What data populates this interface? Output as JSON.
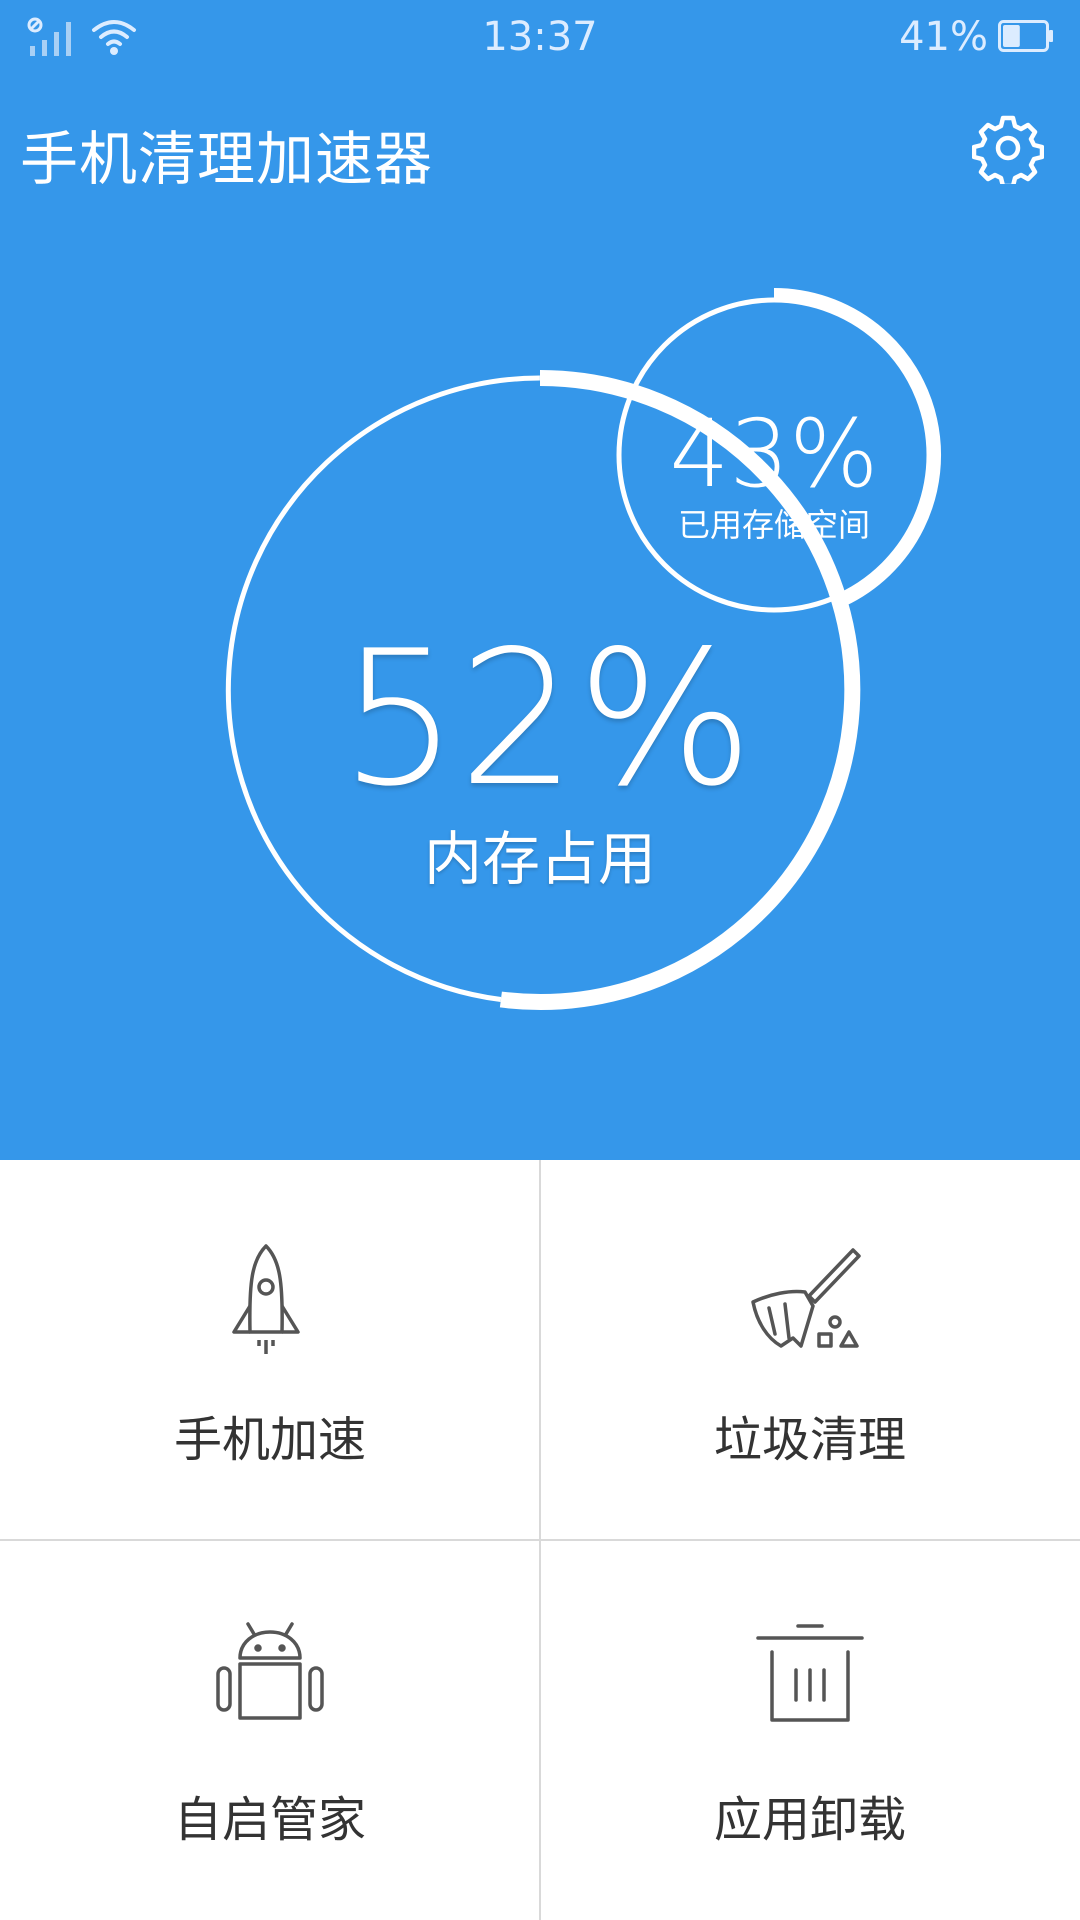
{
  "statusbar": {
    "time": "13:37",
    "battery": "41%",
    "battery_level": 0.41,
    "icons": [
      "signal-icon",
      "wifi-icon",
      "battery-icon"
    ]
  },
  "appbar": {
    "title": "手机清理加速器",
    "settings_icon": "gear-icon"
  },
  "dashboard": {
    "memory": {
      "value": "52%",
      "label": "内存占用",
      "fraction": 0.52
    },
    "storage": {
      "value": "43%",
      "label": "已用存储空间",
      "fraction": 0.43
    }
  },
  "tools": [
    {
      "label": "手机加速",
      "icon": "rocket-icon"
    },
    {
      "label": "垃圾清理",
      "icon": "broom-icon"
    },
    {
      "label": "自启管家",
      "icon": "android-icon"
    },
    {
      "label": "应用卸载",
      "icon": "trash-icon"
    }
  ],
  "colors": {
    "primary": "#3597EA",
    "ring": "#FFFFFF",
    "label": "#333333",
    "icon": "#555555",
    "divider": "#D9D9D9"
  }
}
